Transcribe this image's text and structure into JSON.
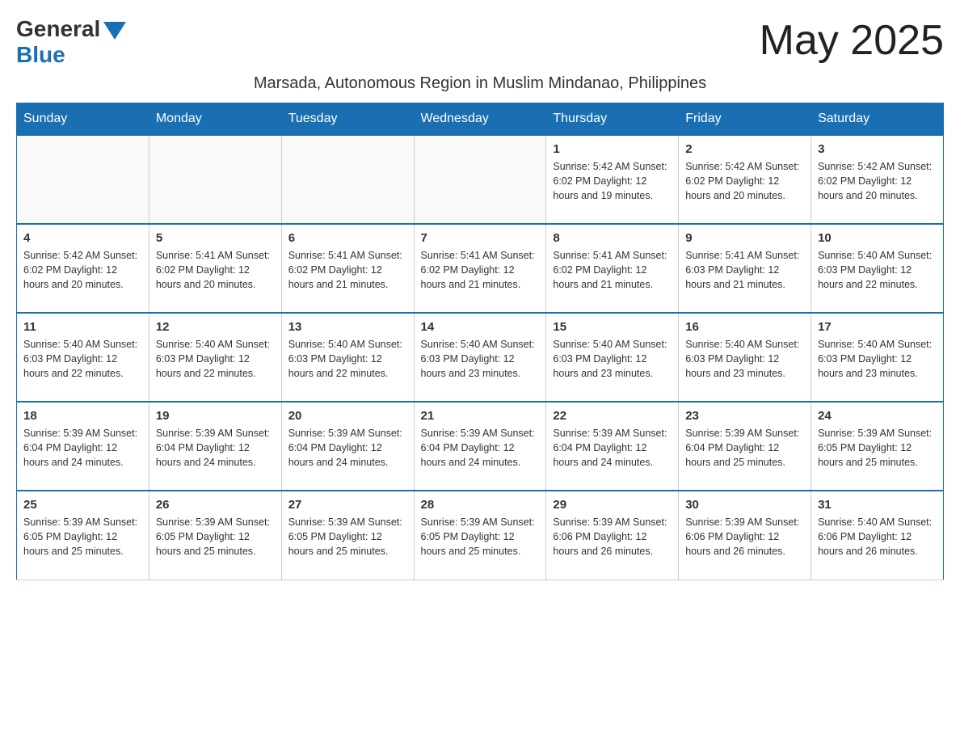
{
  "logo": {
    "general": "General",
    "blue": "Blue"
  },
  "title": "May 2025",
  "subtitle": "Marsada, Autonomous Region in Muslim Mindanao, Philippines",
  "weekdays": [
    "Sunday",
    "Monday",
    "Tuesday",
    "Wednesday",
    "Thursday",
    "Friday",
    "Saturday"
  ],
  "weeks": [
    [
      {
        "day": "",
        "info": ""
      },
      {
        "day": "",
        "info": ""
      },
      {
        "day": "",
        "info": ""
      },
      {
        "day": "",
        "info": ""
      },
      {
        "day": "1",
        "info": "Sunrise: 5:42 AM\nSunset: 6:02 PM\nDaylight: 12 hours and 19 minutes."
      },
      {
        "day": "2",
        "info": "Sunrise: 5:42 AM\nSunset: 6:02 PM\nDaylight: 12 hours and 20 minutes."
      },
      {
        "day": "3",
        "info": "Sunrise: 5:42 AM\nSunset: 6:02 PM\nDaylight: 12 hours and 20 minutes."
      }
    ],
    [
      {
        "day": "4",
        "info": "Sunrise: 5:42 AM\nSunset: 6:02 PM\nDaylight: 12 hours and 20 minutes."
      },
      {
        "day": "5",
        "info": "Sunrise: 5:41 AM\nSunset: 6:02 PM\nDaylight: 12 hours and 20 minutes."
      },
      {
        "day": "6",
        "info": "Sunrise: 5:41 AM\nSunset: 6:02 PM\nDaylight: 12 hours and 21 minutes."
      },
      {
        "day": "7",
        "info": "Sunrise: 5:41 AM\nSunset: 6:02 PM\nDaylight: 12 hours and 21 minutes."
      },
      {
        "day": "8",
        "info": "Sunrise: 5:41 AM\nSunset: 6:02 PM\nDaylight: 12 hours and 21 minutes."
      },
      {
        "day": "9",
        "info": "Sunrise: 5:41 AM\nSunset: 6:03 PM\nDaylight: 12 hours and 21 minutes."
      },
      {
        "day": "10",
        "info": "Sunrise: 5:40 AM\nSunset: 6:03 PM\nDaylight: 12 hours and 22 minutes."
      }
    ],
    [
      {
        "day": "11",
        "info": "Sunrise: 5:40 AM\nSunset: 6:03 PM\nDaylight: 12 hours and 22 minutes."
      },
      {
        "day": "12",
        "info": "Sunrise: 5:40 AM\nSunset: 6:03 PM\nDaylight: 12 hours and 22 minutes."
      },
      {
        "day": "13",
        "info": "Sunrise: 5:40 AM\nSunset: 6:03 PM\nDaylight: 12 hours and 22 minutes."
      },
      {
        "day": "14",
        "info": "Sunrise: 5:40 AM\nSunset: 6:03 PM\nDaylight: 12 hours and 23 minutes."
      },
      {
        "day": "15",
        "info": "Sunrise: 5:40 AM\nSunset: 6:03 PM\nDaylight: 12 hours and 23 minutes."
      },
      {
        "day": "16",
        "info": "Sunrise: 5:40 AM\nSunset: 6:03 PM\nDaylight: 12 hours and 23 minutes."
      },
      {
        "day": "17",
        "info": "Sunrise: 5:40 AM\nSunset: 6:03 PM\nDaylight: 12 hours and 23 minutes."
      }
    ],
    [
      {
        "day": "18",
        "info": "Sunrise: 5:39 AM\nSunset: 6:04 PM\nDaylight: 12 hours and 24 minutes."
      },
      {
        "day": "19",
        "info": "Sunrise: 5:39 AM\nSunset: 6:04 PM\nDaylight: 12 hours and 24 minutes."
      },
      {
        "day": "20",
        "info": "Sunrise: 5:39 AM\nSunset: 6:04 PM\nDaylight: 12 hours and 24 minutes."
      },
      {
        "day": "21",
        "info": "Sunrise: 5:39 AM\nSunset: 6:04 PM\nDaylight: 12 hours and 24 minutes."
      },
      {
        "day": "22",
        "info": "Sunrise: 5:39 AM\nSunset: 6:04 PM\nDaylight: 12 hours and 24 minutes."
      },
      {
        "day": "23",
        "info": "Sunrise: 5:39 AM\nSunset: 6:04 PM\nDaylight: 12 hours and 25 minutes."
      },
      {
        "day": "24",
        "info": "Sunrise: 5:39 AM\nSunset: 6:05 PM\nDaylight: 12 hours and 25 minutes."
      }
    ],
    [
      {
        "day": "25",
        "info": "Sunrise: 5:39 AM\nSunset: 6:05 PM\nDaylight: 12 hours and 25 minutes."
      },
      {
        "day": "26",
        "info": "Sunrise: 5:39 AM\nSunset: 6:05 PM\nDaylight: 12 hours and 25 minutes."
      },
      {
        "day": "27",
        "info": "Sunrise: 5:39 AM\nSunset: 6:05 PM\nDaylight: 12 hours and 25 minutes."
      },
      {
        "day": "28",
        "info": "Sunrise: 5:39 AM\nSunset: 6:05 PM\nDaylight: 12 hours and 25 minutes."
      },
      {
        "day": "29",
        "info": "Sunrise: 5:39 AM\nSunset: 6:06 PM\nDaylight: 12 hours and 26 minutes."
      },
      {
        "day": "30",
        "info": "Sunrise: 5:39 AM\nSunset: 6:06 PM\nDaylight: 12 hours and 26 minutes."
      },
      {
        "day": "31",
        "info": "Sunrise: 5:40 AM\nSunset: 6:06 PM\nDaylight: 12 hours and 26 minutes."
      }
    ]
  ]
}
